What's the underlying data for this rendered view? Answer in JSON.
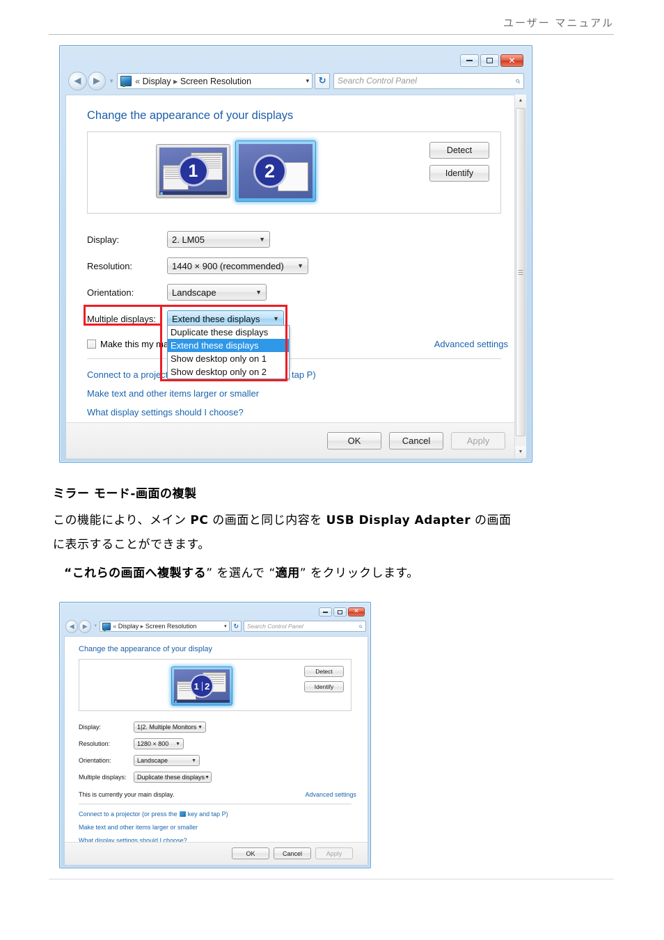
{
  "page": {
    "header_text": "ユーザー マニュアル"
  },
  "dialog1": {
    "caption": {
      "minimize": "–",
      "maximize": "□",
      "close": "✕"
    },
    "address": {
      "back_icon": "back-arrow-icon",
      "forward_icon": "forward-arrow-icon",
      "history_icon": "history-chevron-icon",
      "cpl_icon": "control-panel-icon",
      "crumb_prefix": "«",
      "crumb_1": "Display",
      "crumb_sep": "▸",
      "crumb_2": "Screen Resolution",
      "dropdown_arrow": "▾",
      "refresh_icon": "↻"
    },
    "search": {
      "placeholder": "Search Control Panel",
      "icon": "search-icon"
    },
    "heading": "Change the appearance of your displays",
    "monitors": [
      {
        "number": "1",
        "selected": false
      },
      {
        "number": "2",
        "selected": true
      }
    ],
    "buttons": {
      "detect": "Detect",
      "identify": "Identify"
    },
    "fields": [
      {
        "label": "Display:",
        "value": "2. LM05"
      },
      {
        "label": "Resolution:",
        "value": "1440 × 900 (recommended)"
      },
      {
        "label": "Orientation:",
        "value": "Landscape"
      },
      {
        "label": "Multiple displays:",
        "value": "Extend these displays"
      }
    ],
    "dropdown_options": [
      "Duplicate these displays",
      "Extend these displays",
      "Show desktop only on 1",
      "Show desktop only on 2"
    ],
    "dropdown_selected": "Extend these displays",
    "checkbox_label": "Make this my ma",
    "advanced_settings": "Advanced settings",
    "links": [
      "Connect to a projector (or press the     key and tap P)",
      "Make text and other items larger or smaller",
      "What display settings should I choose?"
    ],
    "link_tail": "tap P)",
    "footer_buttons": {
      "ok": "OK",
      "cancel": "Cancel",
      "apply": "Apply"
    },
    "highlight_color": "#ee1c25"
  },
  "body_text": {
    "heading": "ミラー モード-画面の複製",
    "paragraph_line1_a": "この機能により、メイン ",
    "paragraph_line1_b": "PC",
    "paragraph_line1_c": " の画面と同じ内容を ",
    "paragraph_line1_d": "USB Display Adapter",
    "paragraph_line1_e": " の画面",
    "paragraph_line2": "に表示することができます。",
    "instruction_a": "“",
    "instruction_b": "これらの画面へ複製する",
    "instruction_c": "” を選んで “",
    "instruction_d": "適用",
    "instruction_e": "” をクリックします。"
  },
  "dialog2": {
    "caption": {
      "minimize": "–",
      "maximize": "□",
      "close": "✕"
    },
    "address": {
      "crumb_prefix": "«",
      "crumb_1": "Display",
      "crumb_sep": "▸",
      "crumb_2": "Screen Resolution",
      "dropdown_arrow": "▾",
      "refresh_icon": "↻"
    },
    "search": {
      "placeholder": "Search Control Panel",
      "icon": "search-icon"
    },
    "heading": "Change the appearance of your display",
    "monitor": {
      "number_left": "1",
      "number_right": "2"
    },
    "buttons": {
      "detect": "Detect",
      "identify": "Identify"
    },
    "fields": [
      {
        "label": "Display:",
        "value": "1|2. Multiple Monitors"
      },
      {
        "label": "Resolution:",
        "value": "1280 × 800"
      },
      {
        "label": "Orientation:",
        "value": "Landscape"
      },
      {
        "label": "Multiple displays:",
        "value": "Duplicate these displays"
      }
    ],
    "main_display_text": "This is currently your main display.",
    "advanced_settings": "Advanced settings",
    "links": [
      "Connect to a projector (or press the",
      "key and tap P)",
      "Make text and other items larger or smaller",
      "What display settings should I choose?"
    ],
    "footer_buttons": {
      "ok": "OK",
      "cancel": "Cancel",
      "apply": "Apply"
    }
  }
}
